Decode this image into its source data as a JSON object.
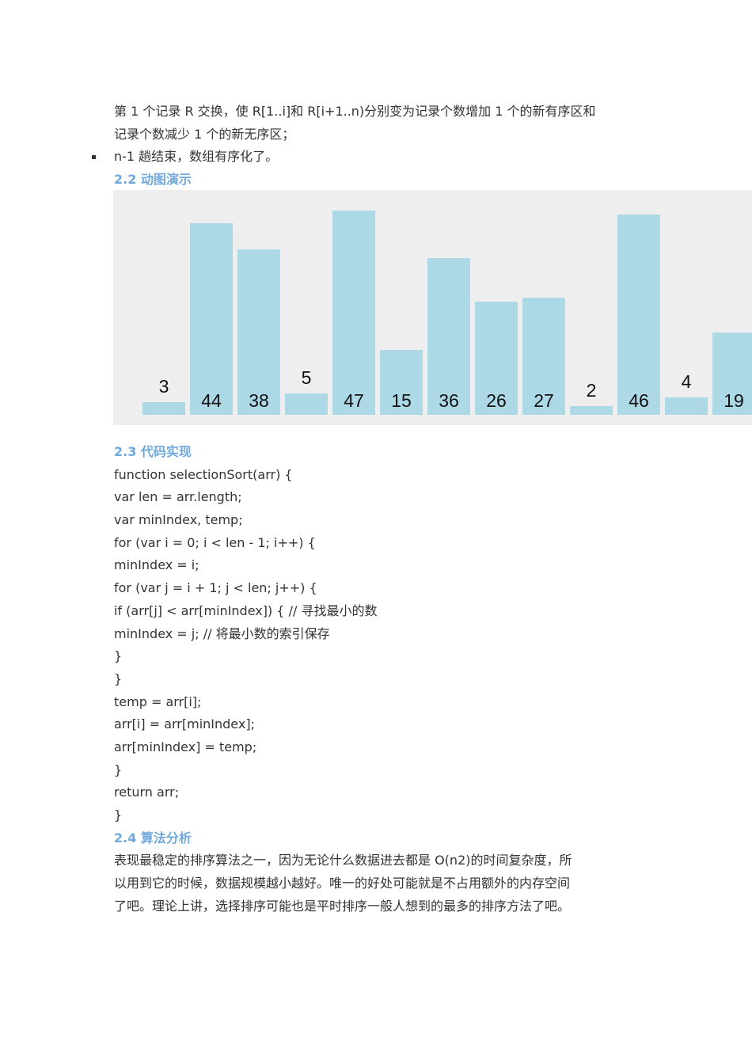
{
  "intro": {
    "lines": [
      "第 1 个记录 R 交换，使 R[1..i]和 R[i+1..n)分别变为记录个数增加 1 个的新有序区和",
      "记录个数减少 1 个的新无序区；"
    ],
    "bullet": "n-1 趟结束，数组有序化了。"
  },
  "section_22": {
    "heading": "2.2 动图演示"
  },
  "chart_data": {
    "type": "bar",
    "values": [
      3,
      44,
      38,
      5,
      47,
      15,
      36,
      26,
      27,
      2,
      46,
      4,
      19
    ],
    "data_labels": [
      "3",
      "44",
      "38",
      "5",
      "47",
      "15",
      "36",
      "26",
      "27",
      "2",
      "46",
      "4",
      "19"
    ],
    "bar_color": "#add8e6",
    "background": "#eeeeee",
    "grid": false
  },
  "section_23": {
    "heading": "2.3 代码实现",
    "code": [
      "function selectionSort(arr) {",
      "var len = arr.length;",
      "var minIndex, temp;",
      "for (var i = 0; i < len - 1; i++) {",
      "minIndex = i;",
      "for (var j = i + 1; j < len; j++) {",
      "if (arr[j] < arr[minIndex]) { // 寻找最小的数",
      "minIndex = j; // 将最小数的索引保存",
      "}",
      "}",
      "temp = arr[i];",
      "arr[i] = arr[minIndex];",
      "arr[minIndex] = temp;",
      "}",
      "return arr;",
      "}"
    ]
  },
  "section_24": {
    "heading": "2.4 算法分析",
    "lines": [
      "表现最稳定的排序算法之一，因为无论什么数据进去都是 O(n2)的时间复杂度，所",
      "以用到它的时候，数据规模越小越好。唯一的好处可能就是不占用额外的内存空间",
      "了吧。理论上讲，选择排序可能也是平时排序一般人想到的最多的排序方法了吧。"
    ]
  },
  "colors": {
    "heading": "#6fa8dc",
    "text": "#333333"
  }
}
